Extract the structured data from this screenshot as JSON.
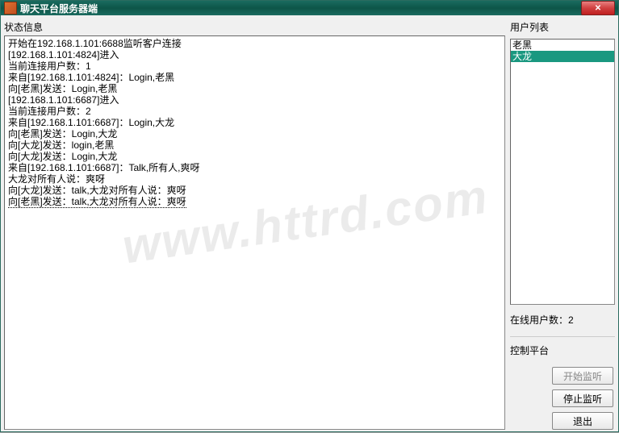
{
  "window": {
    "title": "聊天平台服务器端"
  },
  "status": {
    "label": "状态信息",
    "lines": [
      "开始在192.168.1.101:6688监听客户连接",
      "[192.168.1.101:4824]进入",
      "当前连接用户数：1",
      "来自[192.168.1.101:4824]：Login,老黑",
      "向[老黑]发送：Login,老黑",
      "[192.168.1.101:6687]进入",
      "当前连接用户数：2",
      "来自[192.168.1.101:6687]：Login,大龙",
      "向[老黑]发送：Login,大龙",
      "向[大龙]发送：login,老黑",
      "向[大龙]发送：Login,大龙",
      "来自[192.168.1.101:6687]：Talk,所有人,爽呀",
      "大龙对所有人说：爽呀",
      "向[大龙]发送：talk,大龙对所有人说：爽呀",
      "向[老黑]发送：talk,大龙对所有人说：爽呀"
    ]
  },
  "userlist": {
    "label": "用户列表",
    "items": [
      {
        "name": "老黑",
        "selected": false
      },
      {
        "name": "大龙",
        "selected": true
      }
    ]
  },
  "online": {
    "label": "在线用户数：",
    "count": "2"
  },
  "control": {
    "label": "控制平台",
    "start_label": "开始监听",
    "stop_label": "停止监听",
    "exit_label": "退出"
  },
  "watermark": "www.httrd.com"
}
